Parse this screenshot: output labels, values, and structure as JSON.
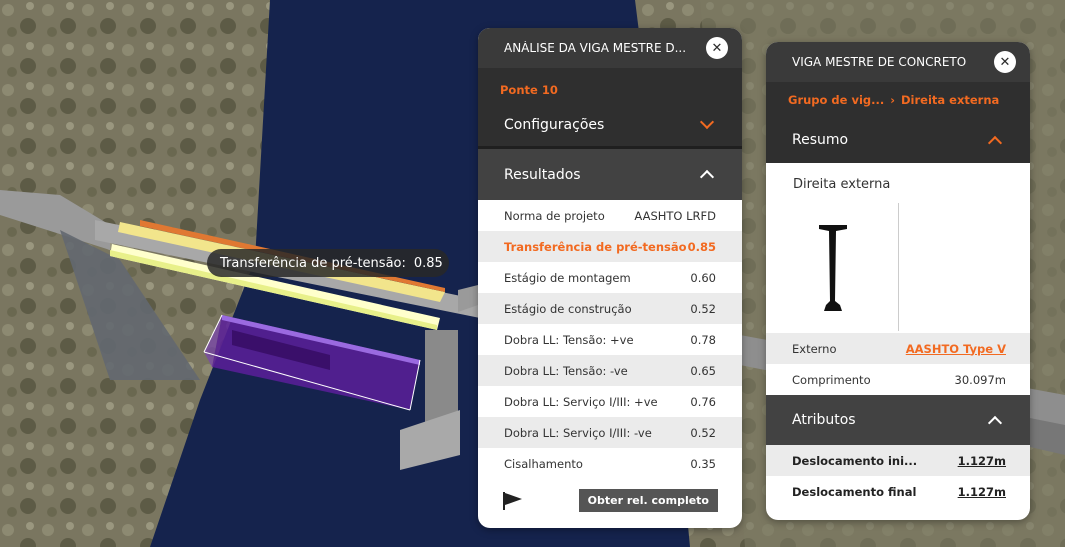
{
  "tooltip": {
    "label": "Transferência de pré-tensão:",
    "value": "0.85"
  },
  "analysis_panel": {
    "title": "ANÁLISE DA VIGA MESTRE D...",
    "subtitle": "Ponte 10",
    "configuracoes_label": "Configurações",
    "resultados_label": "Resultados",
    "rows": [
      {
        "label": "Norma de projeto",
        "value": "AASHTO LRFD"
      },
      {
        "label": "Transferência de pré-tensão",
        "value": "0.85"
      },
      {
        "label": "Estágio de montagem",
        "value": "0.60"
      },
      {
        "label": "Estágio de construção",
        "value": "0.52"
      },
      {
        "label": "Dobra LL: Tensão: +ve",
        "value": "0.78"
      },
      {
        "label": "Dobra LL: Tensão: -ve",
        "value": "0.65"
      },
      {
        "label": "Dobra LL: Serviço I/III: +ve",
        "value": "0.76"
      },
      {
        "label": "Dobra LL: Serviço I/III: -ve",
        "value": "0.52"
      },
      {
        "label": "Cisalhamento",
        "value": "0.35"
      }
    ],
    "report_button": "Obter rel. completo"
  },
  "girder_panel": {
    "title": "VIGA MESTRE DE CONCRETO",
    "breadcrumb": [
      "Grupo de vig...",
      "Direita externa"
    ],
    "resumo_label": "Resumo",
    "summary_title": "Direita externa",
    "specs": [
      {
        "label": "Externo",
        "value": "AASHTO Type V"
      },
      {
        "label": "Comprimento",
        "value": "30.097m"
      }
    ],
    "atributos_label": "Atributos",
    "attributes": [
      {
        "label": "Deslocamento ini...",
        "value": "1.127m"
      },
      {
        "label": "Deslocamento final",
        "value": "1.127m"
      }
    ]
  },
  "colors": {
    "accent": "#f26a21",
    "header": "#3a3a3a",
    "river": "#15234d"
  },
  "icons": [
    "close-icon",
    "chevron-down-icon",
    "chevron-up-icon",
    "flag-icon",
    "chevron-right-icon",
    "i-beam-icon"
  ]
}
